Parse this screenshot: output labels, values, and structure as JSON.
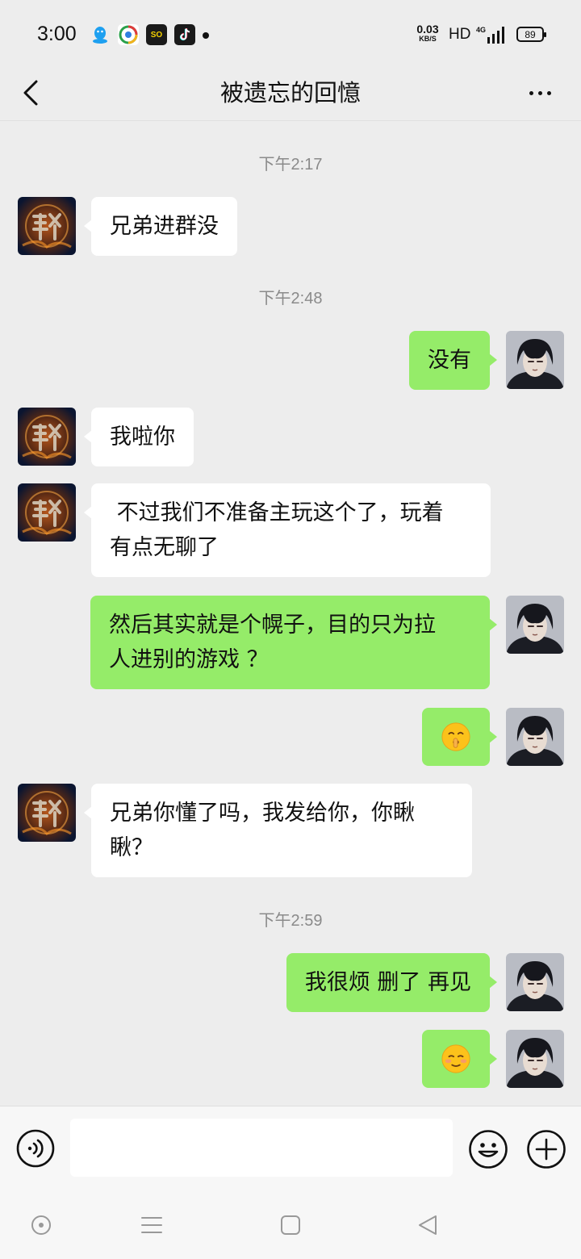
{
  "status_bar": {
    "time": "3:00",
    "net_speed_value": "0.03",
    "net_speed_unit": "KB/S",
    "hd": "HD",
    "network": "4G",
    "battery": "89",
    "apps": [
      {
        "icon": "qq-icon",
        "color": "#1ea0f0"
      },
      {
        "icon": "browser-icon",
        "color": "#ffffff"
      },
      {
        "icon": "soul-app-icon",
        "label": "SO",
        "color": "#1a1a1a"
      },
      {
        "icon": "tiktok-icon",
        "color": "#1a1a1a"
      }
    ]
  },
  "header": {
    "title": "被遗忘的回憶"
  },
  "messages": [
    {
      "kind": "time",
      "text": "下午2:17"
    },
    {
      "kind": "in",
      "text": "兄弟进群没"
    },
    {
      "kind": "time",
      "text": "下午2:48"
    },
    {
      "kind": "out",
      "text": "没有"
    },
    {
      "kind": "in",
      "text": "我啦你"
    },
    {
      "kind": "in",
      "lines": [
        " 不过我们不准备主玩这个了，玩着",
        "有点无聊了"
      ]
    },
    {
      "kind": "out",
      "lines": [
        "然后其实就是个幌子，目的只为拉",
        "人进别的游戏 ？"
      ]
    },
    {
      "kind": "out",
      "emoji": "shushing-face-emoji"
    },
    {
      "kind": "in",
      "lines": [
        "兄弟你懂了吗，我发给你，你瞅",
        "瞅？"
      ]
    },
    {
      "kind": "time",
      "text": "下午2:59"
    },
    {
      "kind": "out",
      "text": "我很烦 删了 再见"
    },
    {
      "kind": "out",
      "emoji": "flushed-smile-emoji"
    }
  ],
  "input_bar": {
    "placeholder": ""
  },
  "colors": {
    "background": "#ededed",
    "outgoing_bubble": "#95ec69",
    "incoming_bubble": "#ffffff",
    "timestamp": "#8a8a8a"
  }
}
